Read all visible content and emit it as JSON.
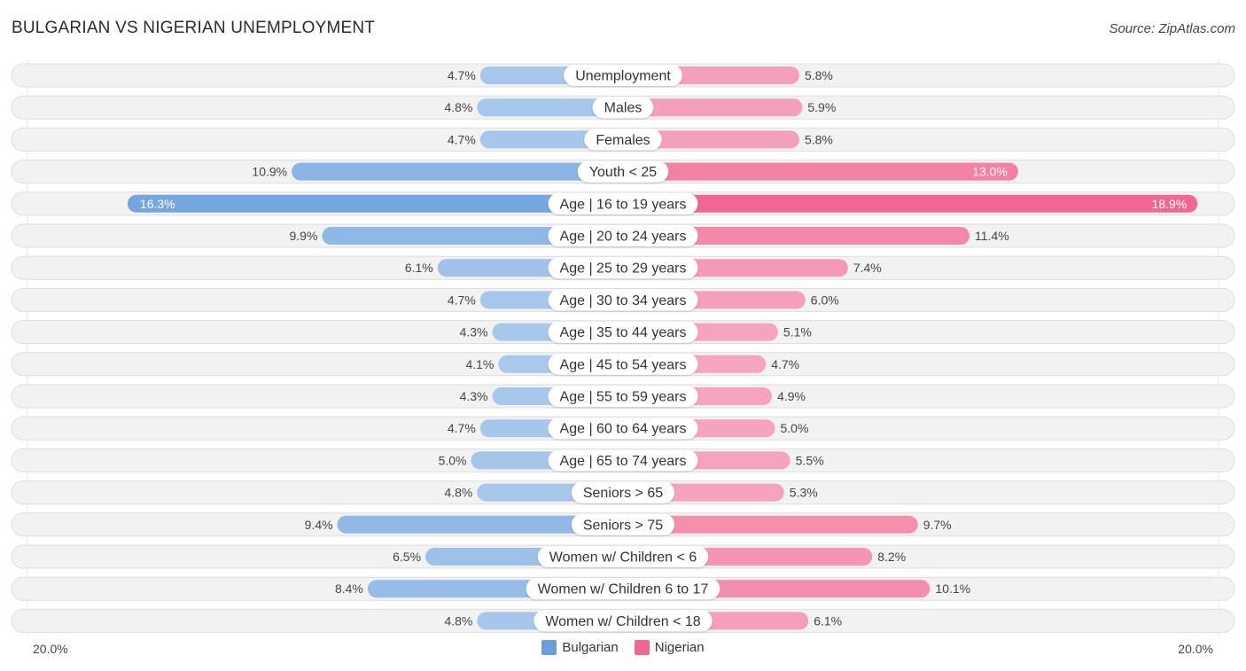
{
  "header": {
    "title": "BULGARIAN VS NIGERIAN UNEMPLOYMENT",
    "source": "Source: ZipAtlas.com"
  },
  "axis": {
    "left_label": "20.0%",
    "right_label": "20.0%"
  },
  "legend": {
    "items": [
      {
        "label": "Bulgarian",
        "color": "#6a9fdc"
      },
      {
        "label": "Nigerian",
        "color": "#f06892"
      }
    ]
  },
  "colors": {
    "bulgarian_strong": "#6a9fdc",
    "bulgarian_light": "#a9c8ec",
    "nigerian_strong": "#f06892",
    "nigerian_light": "#f6a8c0",
    "row_bg": "#f2f2f2",
    "row_border": "#dedede"
  },
  "chart_data": {
    "type": "bar",
    "orientation": "horizontal-diverging",
    "title": "BULGARIAN VS NIGERIAN UNEMPLOYMENT",
    "xlabel": "",
    "ylabel": "",
    "xlim": [
      -20,
      20
    ],
    "unit": "%",
    "legend_position": "bottom-center",
    "categories": [
      "Unemployment",
      "Males",
      "Females",
      "Youth < 25",
      "Age | 16 to 19 years",
      "Age | 20 to 24 years",
      "Age | 25 to 29 years",
      "Age | 30 to 34 years",
      "Age | 35 to 44 years",
      "Age | 45 to 54 years",
      "Age | 55 to 59 years",
      "Age | 60 to 64 years",
      "Age | 65 to 74 years",
      "Seniors > 65",
      "Seniors > 75",
      "Women w/ Children < 6",
      "Women w/ Children 6 to 17",
      "Women w/ Children < 18"
    ],
    "series": [
      {
        "name": "Bulgarian",
        "side": "left",
        "values": [
          4.7,
          4.8,
          4.7,
          10.9,
          16.3,
          9.9,
          6.1,
          4.7,
          4.3,
          4.1,
          4.3,
          4.7,
          5.0,
          4.8,
          9.4,
          6.5,
          8.4,
          4.8
        ],
        "labels": [
          "4.7%",
          "4.8%",
          "4.7%",
          "10.9%",
          "16.3%",
          "9.9%",
          "6.1%",
          "4.7%",
          "4.3%",
          "4.1%",
          "4.3%",
          "4.7%",
          "5.0%",
          "4.8%",
          "9.4%",
          "6.5%",
          "8.4%",
          "4.8%"
        ]
      },
      {
        "name": "Nigerian",
        "side": "right",
        "values": [
          5.8,
          5.9,
          5.8,
          13.0,
          18.9,
          11.4,
          7.4,
          6.0,
          5.1,
          4.7,
          4.9,
          5.0,
          5.5,
          5.3,
          9.7,
          8.2,
          10.1,
          6.1
        ],
        "labels": [
          "5.8%",
          "5.9%",
          "5.8%",
          "13.0%",
          "18.9%",
          "11.4%",
          "7.4%",
          "6.0%",
          "5.1%",
          "4.7%",
          "4.9%",
          "5.0%",
          "5.5%",
          "5.3%",
          "9.7%",
          "8.2%",
          "10.1%",
          "6.1%"
        ]
      }
    ]
  }
}
